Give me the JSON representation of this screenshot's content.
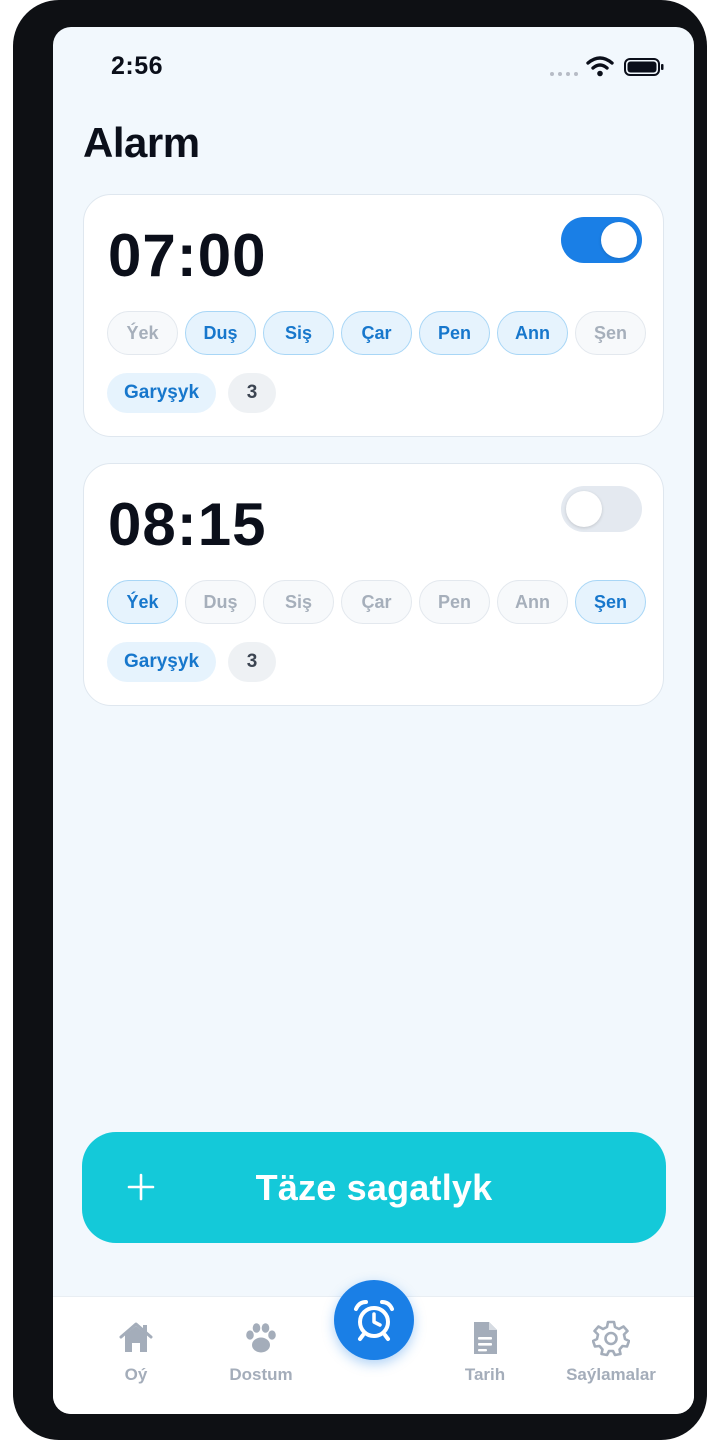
{
  "status_bar": {
    "time": "2:56"
  },
  "header": {
    "title": "Alarm"
  },
  "alarms": [
    {
      "time": "07:00",
      "enabled": true,
      "days": [
        {
          "label": "Ýek",
          "active": false
        },
        {
          "label": "Duş",
          "active": true
        },
        {
          "label": "Siş",
          "active": true
        },
        {
          "label": "Çar",
          "active": true
        },
        {
          "label": "Pen",
          "active": true
        },
        {
          "label": "Ann",
          "active": true
        },
        {
          "label": "Şen",
          "active": false
        }
      ],
      "mode": "Garyşyk",
      "count": "3"
    },
    {
      "time": "08:15",
      "enabled": false,
      "days": [
        {
          "label": "Ýek",
          "active": true
        },
        {
          "label": "Duş",
          "active": false
        },
        {
          "label": "Siş",
          "active": false
        },
        {
          "label": "Çar",
          "active": false
        },
        {
          "label": "Pen",
          "active": false
        },
        {
          "label": "Ann",
          "active": false
        },
        {
          "label": "Şen",
          "active": true
        }
      ],
      "mode": "Garyşyk",
      "count": "3"
    }
  ],
  "add_button": {
    "icon": "plus-icon",
    "label": "Täze sagatlyk"
  },
  "tabbar": {
    "items": [
      {
        "label": "Oý",
        "icon": "home-icon"
      },
      {
        "label": "Dostum",
        "icon": "paw-icon"
      },
      {
        "label": "",
        "icon": "alarm-clock-icon",
        "active": true
      },
      {
        "label": "Tarih",
        "icon": "document-icon"
      },
      {
        "label": "Saýlamalar",
        "icon": "gear-icon"
      }
    ]
  },
  "colors": {
    "accent_blue": "#1a7fe6",
    "add_button": "#14c9d9",
    "background": "#f2f8fd"
  }
}
